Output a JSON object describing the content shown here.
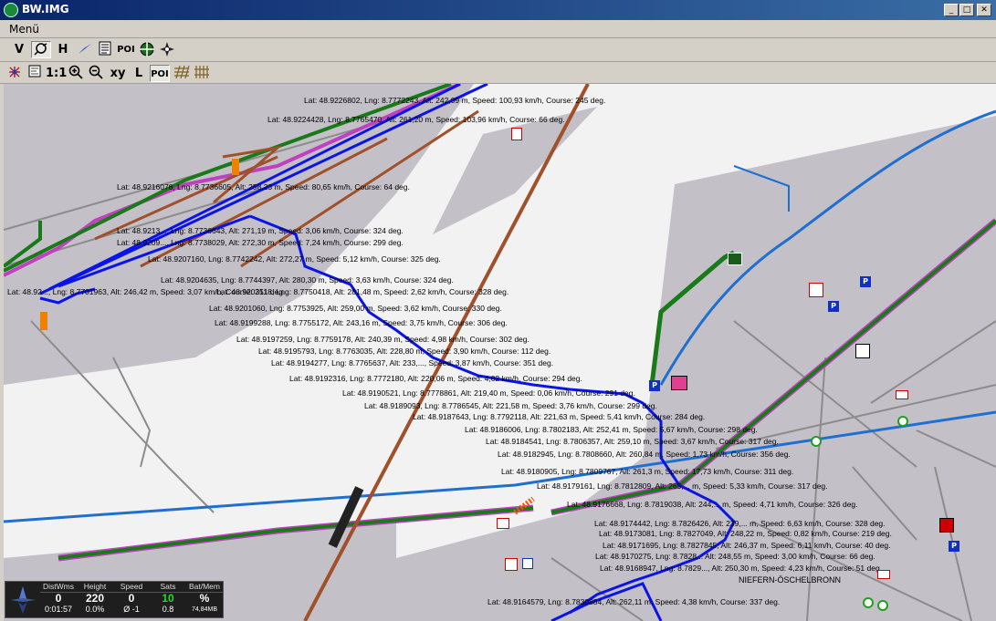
{
  "window": {
    "title": "BW.IMG",
    "minimize_glyph": "_",
    "maximize_glyph": "□",
    "close_glyph": "✕"
  },
  "menubar": {
    "menu_label": "Menü"
  },
  "toolbar1": [
    {
      "label": "V"
    },
    {
      "label": "",
      "icon": "track-tools-icon"
    },
    {
      "label": "H"
    },
    {
      "label": "",
      "icon": "arrow-pointer-icon"
    },
    {
      "label": "",
      "icon": "list-icon"
    },
    {
      "label": "POI"
    },
    {
      "label": "",
      "icon": "target-icon"
    },
    {
      "label": "",
      "icon": "compass-icon"
    }
  ],
  "toolbar2": [
    {
      "label": "",
      "icon": "satellite-icon"
    },
    {
      "label": "",
      "icon": "map-select-icon"
    },
    {
      "label": "1:1"
    },
    {
      "label": "",
      "icon": "zoom-in-icon"
    },
    {
      "label": "",
      "icon": "zoom-out-icon"
    },
    {
      "label": "xy"
    },
    {
      "label": "L"
    },
    {
      "label": "POI"
    },
    {
      "label": "",
      "icon": "grid-icon"
    },
    {
      "label": "",
      "icon": "hatched-grid-icon"
    }
  ],
  "map": {
    "place_label": "NIEFERN-ÖSCHELBRONN",
    "track_points": [
      "Lat: 48.9226802, Lng: 8.7772243, Alt: 242,09 m, Speed: 100,93 km/h, Course: 245 deg.",
      "Lat: 48.9224428, Lng: 8.7765470, Alt: 261,20 m, Speed: 103,96 km/h, Course: 66 deg.",
      "Lat: 48.9216078, Lng: 8.7736605, Alt: 258,23 m, Speed: 80,65 km/h, Course: 64 deg.",
      "Lat: 48.9213..., Lng: 8.7736643, Alt: 271,19 m, Speed: 3,06 km/h, Course: 324 deg.",
      "Lat: 48.9209..., Lng: 8.7738029, Alt: 272,30 m, Speed: 7,24 km/h, Course: 299 deg.",
      "Lat: 48.9207160, Lng: 8.7742242, Alt: 272,27 m, Speed: 5,12 km/h, Course: 325 deg.",
      "Lat: 48.9204635, Lng: 8.7744397, Alt: 280,30 m, Speed: 3,63 km/h, Course: 324 deg.",
      "Lat: 48.9203118, Lng: 8.7750418, Alt: 281,48 m, Speed: 2,62 km/h, Course: 328 deg.",
      "Lat: 48.92..., Lng: 8.7701963, Alt: 246,42 m, Speed: 3,07 km/h, Course: 251 deg.",
      "Lat: 48.9201060, Lng: 8.7753925, Alt: 259,00 m, Speed: 3,62 km/h, Course: 330 deg.",
      "Lat: 48.9199288, Lng: 8.7755172, Alt: 243,16 m, Speed: 3,75 km/h, Course: 306 deg.",
      "Lat: 48.9197259, Lng: 8.7759178, Alt: 240,39 m, Speed: 4,98 km/h, Course: 302 deg.",
      "Lat: 48.9195793, Lng: 8.7763035, Alt: 228,80 m, Speed: 3,90 km/h, Course: 112 deg.",
      "Lat: 48.9194277, Lng: 8.7765637, Alt: 233,..., Speed: 3,87 km/h, Course: 351 deg.",
      "Lat: 48.9192316, Lng: 8.7772180, Alt: 220,06 m, Speed: 4,02 km/h, Course: 294 deg.",
      "Lat: 48.9190521, Lng: 8.7778861, Alt: 219,40 m, Speed: 0,06 km/h, Course: 291 deg.",
      "Lat: 48.9189093, Lng: 8.7786545, Alt: 221,58 m, Speed: 3,76 km/h, Course: 299 deg.",
      "Lat: 48.9187643, Lng: 8.7792118, Alt: 221,63 m, Speed: 5,41 km/h, Course: 284 deg.",
      "Lat: 48.9186006, Lng: 8.7802183, Alt: 252,41 m, Speed: 5,67 km/h, Course: 298 deg.",
      "Lat: 48.9184541, Lng: 8.7806357, Alt: 259,10 m, Speed: 3,67 km/h, Course: 317 deg.",
      "Lat: 48.9182945, Lng: 8.7808660, Alt: 260,84 m, Speed: 1,73 km/h, Course: 356 deg.",
      "Lat: 48.9180905, Lng: 8.7809767, Alt: 261,3 m, Speed: 17,73 km/h, Course: 311 deg.",
      "Lat: 48.9179161, Lng: 8.7812809, Alt: 265,... m, Speed: 5,33 km/h, Course: 317 deg.",
      "Lat: 48.9176668, Lng: 8.7819038, Alt: 244,... m, Speed: 4,71 km/h, Course: 326 deg.",
      "Lat: 48.9174442, Lng: 8.7826426, Alt: 239,... m, Speed: 6,63 km/h, Course: 328 deg.",
      "Lat: 48.9173081, Lng: 8.7827049, Alt: 248,22 m, Speed: 0,82 km/h, Course: 219 deg.",
      "Lat: 48.9171695, Lng: 8.7827845, Alt: 246,37 m, Speed: 6,11 km/h, Course: 40 deg.",
      "Lat: 48.9170275, Lng: 8.7828... Alt: 248,55 m, Speed: 3,00 km/h, Course: 66 deg.",
      "Lat: 48.9168947, Lng: 8.7829..., Alt: 250,30 m, Speed: 4,23 km/h, Course: 51 deg.",
      "Lat: 48.9164579, Lng: 8.7830884, Alt: 262,11 m, Speed: 4,38 km/h, Course: 337 deg."
    ]
  },
  "status": {
    "columns": [
      {
        "header": "DistWms",
        "value": "0",
        "sub": "0:01:57"
      },
      {
        "header": "Height",
        "value": "220",
        "sub": "0.0%"
      },
      {
        "header": "Speed",
        "value": "0",
        "sub": "Ø -1"
      },
      {
        "header": "Sats",
        "value": "10",
        "sub": "0.8"
      },
      {
        "header": "Bat/Mem",
        "value": "%",
        "sub": "74,84MB"
      }
    ],
    "sats_color": "#22dd22"
  },
  "colors": {
    "track": "#0a14e6",
    "railway": "#a0502a",
    "river": "#1e6fd0",
    "highway": "#1a7a1a",
    "highway_edge": "#c040c0",
    "street": "#8c8c8c"
  }
}
